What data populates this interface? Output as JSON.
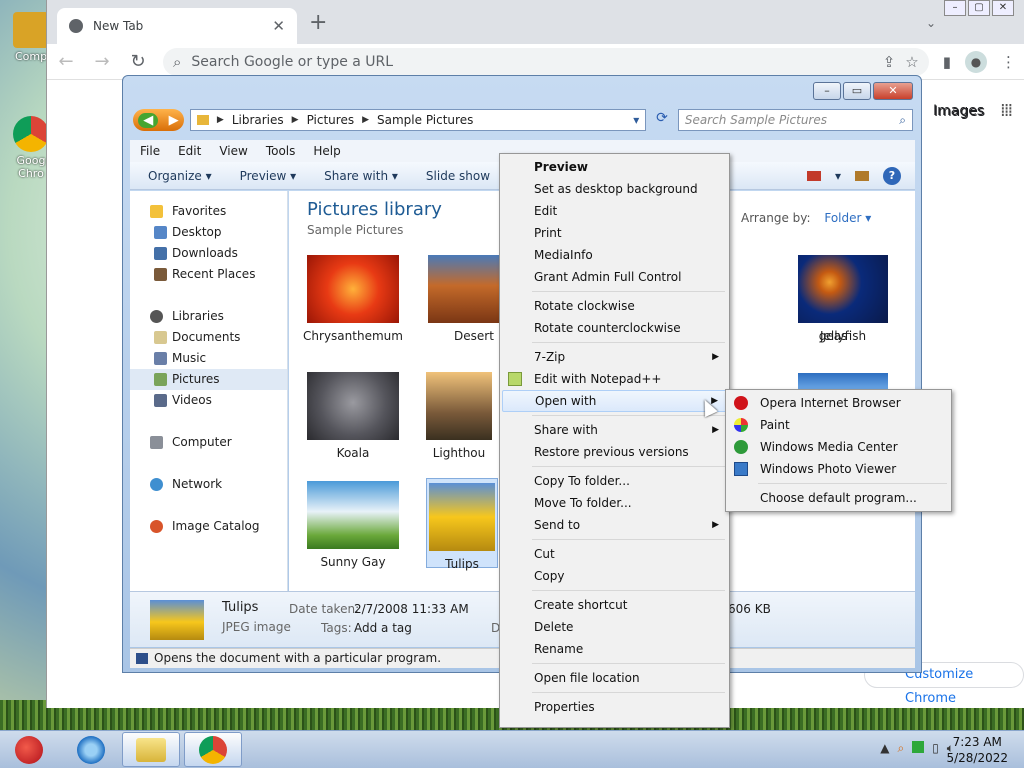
{
  "desktop": {
    "icons": [
      {
        "label": "Comp"
      },
      {
        "label": "Goog Chro"
      }
    ]
  },
  "chrome": {
    "tab_title": "New Tab",
    "omnibox_placeholder": "Search Google or type a URL",
    "images_link": "Images",
    "customize_label": "Customize Chrome"
  },
  "explorer": {
    "breadcrumb": [
      "Libraries",
      "Pictures",
      "Sample Pictures"
    ],
    "search_placeholder": "Search Sample Pictures",
    "menu": [
      "File",
      "Edit",
      "View",
      "Tools",
      "Help"
    ],
    "commands": [
      "Organize ▾",
      "Preview ▾",
      "Share with ▾",
      "Slide show"
    ],
    "nav": {
      "favorites": "Favorites",
      "desktop": "Desktop",
      "downloads": "Downloads",
      "recent": "Recent Places",
      "libraries": "Libraries",
      "documents": "Documents",
      "music": "Music",
      "pictures": "Pictures",
      "videos": "Videos",
      "computer": "Computer",
      "network": "Network",
      "image_catalog": "Image Catalog"
    },
    "library_title": "Pictures library",
    "library_sub": "Sample Pictures",
    "arrange_label": "Arrange by:",
    "arrange_value": "Folder",
    "thumbnails": [
      "Chrysanthemum",
      "Desert",
      "geas",
      "Jellyfish",
      "Koala",
      "Lighthou",
      "Sunny Gay",
      "Tulips"
    ],
    "details": {
      "name": "Tulips",
      "type": "JPEG image",
      "date_label": "Date taken:",
      "date_value": "2/7/2008 11:33 AM",
      "tags_label": "Tags:",
      "tags_value": "Add a tag",
      "size_fragment": "606 KB",
      "d_fragment": "D"
    },
    "status": "Opens the document with a particular program."
  },
  "context_menu": {
    "preview": "Preview",
    "desktop_bg": "Set as desktop background",
    "edit": "Edit",
    "print": "Print",
    "mediainfo": "MediaInfo",
    "grant": "Grant Admin Full Control",
    "rotate_cw": "Rotate clockwise",
    "rotate_ccw": "Rotate counterclockwise",
    "zip": "7-Zip",
    "notepad": "Edit with Notepad++",
    "open_with": "Open with",
    "share_with": "Share with",
    "restore": "Restore previous versions",
    "copy_to": "Copy To folder...",
    "move_to": "Move To folder...",
    "send_to": "Send to",
    "cut": "Cut",
    "copy": "Copy",
    "shortcut": "Create shortcut",
    "delete": "Delete",
    "rename": "Rename",
    "open_location": "Open file location",
    "properties": "Properties"
  },
  "submenu": {
    "opera": "Opera Internet Browser",
    "paint": "Paint",
    "wmc": "Windows Media Center",
    "wpv": "Windows Photo Viewer",
    "choose": "Choose default program..."
  },
  "taskbar": {
    "time": "7:23 AM",
    "date": "5/28/2022"
  },
  "colors": {
    "accent": "#1e5b94",
    "link": "#1a73e8"
  }
}
